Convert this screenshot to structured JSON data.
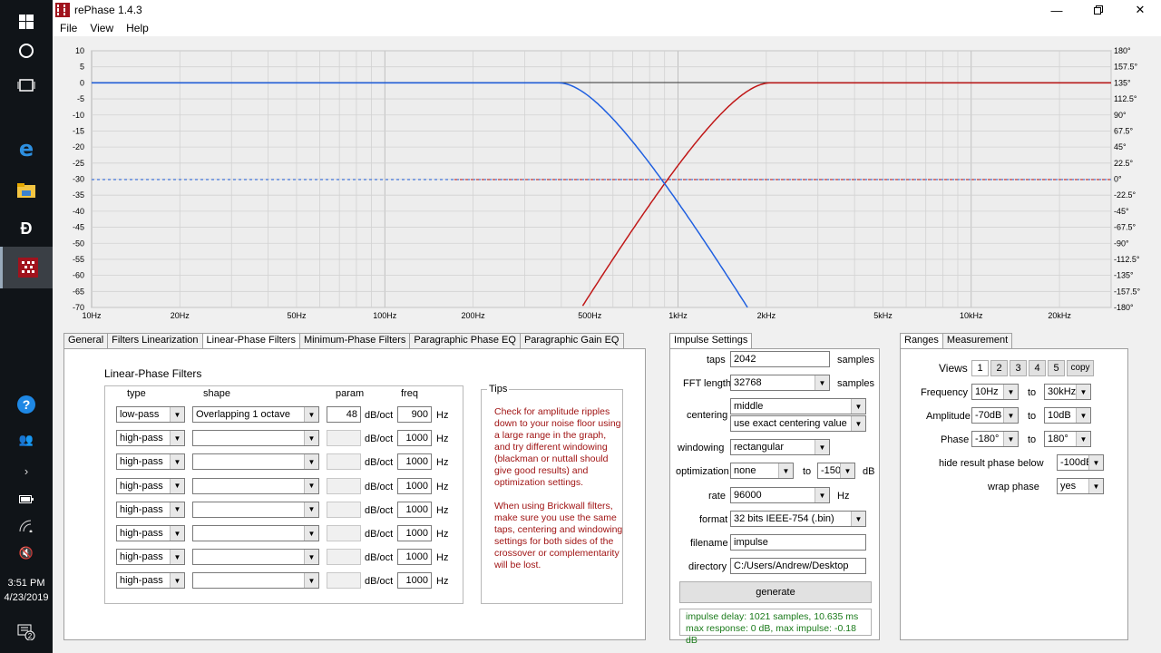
{
  "window": {
    "title": "rePhase 1.4.3"
  },
  "menu": [
    "File",
    "View",
    "Help"
  ],
  "taskbar": {
    "time": "3:51 PM",
    "date": "4/23/2019",
    "notification_count": "2"
  },
  "graph": {
    "left_axis": [
      "10",
      "5",
      "0",
      "-5",
      "-10",
      "-15",
      "-20",
      "-25",
      "-30",
      "-35",
      "-40",
      "-45",
      "-50",
      "-55",
      "-60",
      "-65",
      "-70"
    ],
    "right_axis": [
      "180°",
      "157.5°",
      "135°",
      "112.5°",
      "90°",
      "67.5°",
      "45°",
      "22.5°",
      "0°",
      "-22.5°",
      "-45°",
      "-67.5°",
      "-90°",
      "-112.5°",
      "-135°",
      "-157.5°",
      "-180°"
    ],
    "freq_labels": [
      {
        "label": "10Hz",
        "f": 10
      },
      {
        "label": "20Hz",
        "f": 20
      },
      {
        "label": "50Hz",
        "f": 50
      },
      {
        "label": "100Hz",
        "f": 100
      },
      {
        "label": "200Hz",
        "f": 200
      },
      {
        "label": "500Hz",
        "f": 500
      },
      {
        "label": "1kHz",
        "f": 1000
      },
      {
        "label": "2kHz",
        "f": 2000
      },
      {
        "label": "5kHz",
        "f": 5000
      },
      {
        "label": "10kHz",
        "f": 10000
      },
      {
        "label": "20kHz",
        "f": 20000
      }
    ],
    "colors": {
      "lowpass": "#1f5fe0",
      "highpass": "#c01818"
    }
  },
  "tabs": [
    "General",
    "Filters Linearization",
    "Linear-Phase Filters",
    "Minimum-Phase Filters",
    "Paragraphic Phase EQ",
    "Paragraphic Gain EQ"
  ],
  "active_tab": "Linear-Phase Filters",
  "lpf": {
    "title": "Linear-Phase Filters",
    "headers": {
      "type": "type",
      "shape": "shape",
      "param": "param",
      "freq": "freq"
    },
    "unit_param": "dB/oct",
    "unit_freq": "Hz",
    "rows": [
      {
        "type": "low-pass",
        "shape": "Overlapping 1 octave",
        "param": "48",
        "freq": "900"
      },
      {
        "type": "high-pass",
        "shape": "",
        "param": "",
        "freq": "1000"
      },
      {
        "type": "high-pass",
        "shape": "",
        "param": "",
        "freq": "1000"
      },
      {
        "type": "high-pass",
        "shape": "",
        "param": "",
        "freq": "1000"
      },
      {
        "type": "high-pass",
        "shape": "",
        "param": "",
        "freq": "1000"
      },
      {
        "type": "high-pass",
        "shape": "",
        "param": "",
        "freq": "1000"
      },
      {
        "type": "high-pass",
        "shape": "",
        "param": "",
        "freq": "1000"
      },
      {
        "type": "high-pass",
        "shape": "",
        "param": "",
        "freq": "1000"
      }
    ]
  },
  "tips": {
    "title": "Tips",
    "p1": "Check for amplitude ripples down to your noise floor using a large range in the graph, and try different windowing (blackman or nuttall should give good results) and optimization settings.",
    "p2": "When using Brickwall filters, make sure you use the same taps, centering and windowing settings for both sides of the crossover or complementarity will be lost."
  },
  "impulse": {
    "tab": "Impulse Settings",
    "taps_label": "taps",
    "taps": "2042",
    "taps_unit": "samples",
    "fft_label": "FFT length",
    "fft": "32768",
    "fft_unit": "samples",
    "centering_label": "centering",
    "centering1": "middle",
    "centering2": "use exact centering value",
    "windowing_label": "windowing",
    "windowing": "rectangular",
    "optimization_label": "optimization",
    "optimization": "none",
    "opt_to": "to",
    "opt_db": "-150",
    "opt_unit": "dB",
    "rate_label": "rate",
    "rate": "96000",
    "rate_unit": "Hz",
    "format_label": "format",
    "format": "32 bits IEEE-754 (.bin)",
    "filename_label": "filename",
    "filename": "impulse",
    "directory_label": "directory",
    "directory": "C:/Users/Andrew/Desktop",
    "generate": "generate",
    "result1": "impulse delay: 1021 samples, 10.635 ms",
    "result2": "max response: 0 dB, max impulse: -0.18 dB"
  },
  "ranges": {
    "tabs": [
      "Ranges",
      "Measurement"
    ],
    "views_label": "Views",
    "views": [
      "1",
      "2",
      "3",
      "4",
      "5"
    ],
    "copy": "copy",
    "frequency_label": "Frequency",
    "freq_from": "10Hz",
    "freq_to": "30kHz",
    "amplitude_label": "Amplitude",
    "amp_from": "-70dB",
    "amp_to": "10dB",
    "phase_label": "Phase",
    "phase_from": "-180°",
    "phase_to": "180°",
    "to": "to",
    "hide_label": "hide result phase below",
    "hide": "-100dB",
    "wrap_label": "wrap phase",
    "wrap": "yes"
  }
}
